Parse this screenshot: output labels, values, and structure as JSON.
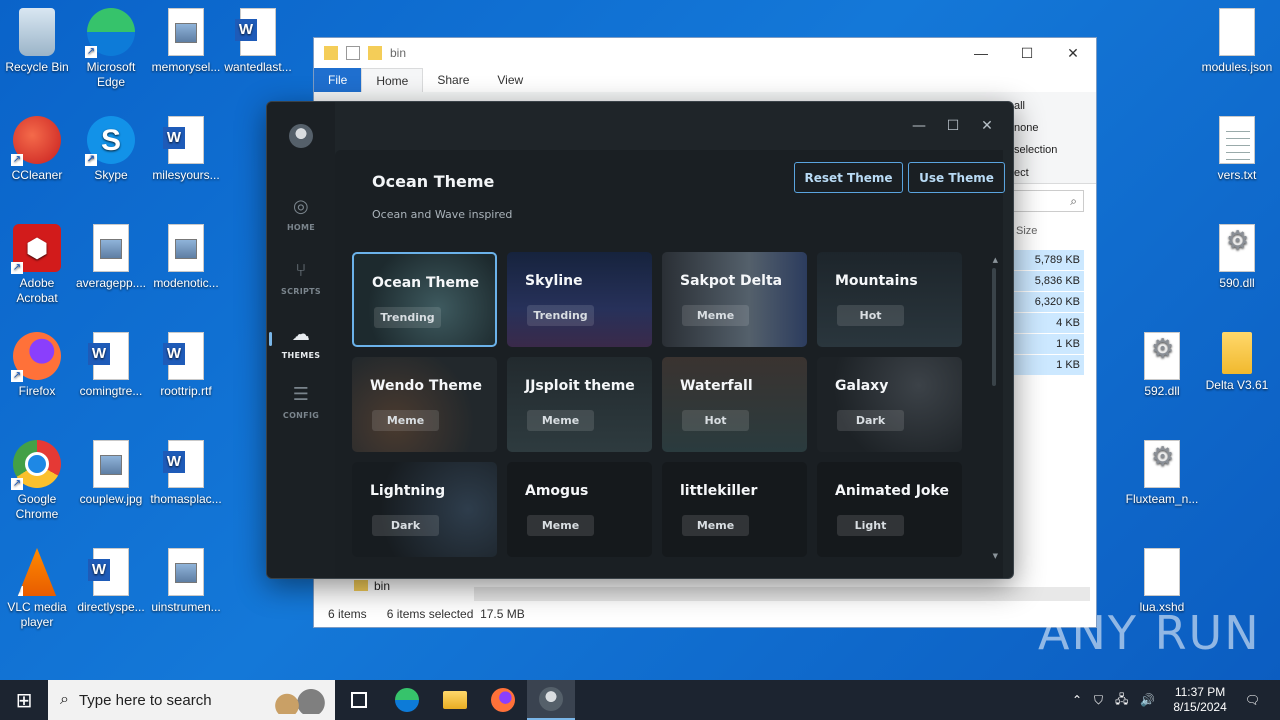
{
  "desktop": {
    "icons": [
      {
        "label": "Recycle Bin"
      },
      {
        "label": "Microsoft Edge"
      },
      {
        "label": "memorysel..."
      },
      {
        "label": "wantedlast..."
      },
      {
        "label": "CCleaner"
      },
      {
        "label": "Skype"
      },
      {
        "label": "milesyours..."
      },
      {
        "label": "Adobe Acrobat"
      },
      {
        "label": "averagepp...."
      },
      {
        "label": "modenotic..."
      },
      {
        "label": "Firefox"
      },
      {
        "label": "comingtre..."
      },
      {
        "label": "roottrip.rtf"
      },
      {
        "label": "Google Chrome"
      },
      {
        "label": "couplew.jpg"
      },
      {
        "label": "thomasplac..."
      },
      {
        "label": "VLC media player"
      },
      {
        "label": "directlyspe..."
      },
      {
        "label": "uinstrumen..."
      },
      {
        "label": "modules.json"
      },
      {
        "label": "vers.txt"
      },
      {
        "label": "590.dll"
      },
      {
        "label": "592.dll"
      },
      {
        "label": "Delta V3.61"
      },
      {
        "label": "Fluxteam_n..."
      },
      {
        "label": "lua.xshd"
      }
    ]
  },
  "explorer": {
    "title": "bin",
    "tabs": [
      "File",
      "Home",
      "Share",
      "View"
    ],
    "ribbon_select": [
      "all",
      "none",
      "selection",
      "ect"
    ],
    "size_header": "Size",
    "sizes": [
      "5,789 KB",
      "5,836 KB",
      "6,320 KB",
      "4 KB",
      "1 KB",
      "1 KB"
    ],
    "nav_folder": "bin",
    "status": {
      "items": "6 items",
      "selected": "6 items selected",
      "size": "17.5 MB"
    }
  },
  "app": {
    "nav": [
      {
        "label": "HOME",
        "icon": "compass-icon"
      },
      {
        "label": "SCRIPTS",
        "icon": "branch-icon"
      },
      {
        "label": "THEMES",
        "icon": "cloud-icon"
      },
      {
        "label": "CONFIG",
        "icon": "sliders-icon"
      }
    ],
    "header": {
      "title": "Ocean Theme",
      "description": "Ocean and Wave inspired",
      "reset_label": "Reset Theme",
      "use_label": "Use Theme"
    },
    "themes": [
      {
        "name": "Ocean Theme",
        "tag": "Trending"
      },
      {
        "name": "Skyline",
        "tag": "Trending"
      },
      {
        "name": "Sakpot Delta",
        "tag": "Meme"
      },
      {
        "name": "Mountains",
        "tag": "Hot"
      },
      {
        "name": "Wendo Theme",
        "tag": "Meme"
      },
      {
        "name": "JJsploit theme",
        "tag": "Meme"
      },
      {
        "name": "Waterfall",
        "tag": "Hot"
      },
      {
        "name": "Galaxy",
        "tag": "Dark"
      },
      {
        "name": "Lightning",
        "tag": "Dark"
      },
      {
        "name": "Amogus",
        "tag": "Meme"
      },
      {
        "name": "littlekiller",
        "tag": "Meme"
      },
      {
        "name": "Animated Joke",
        "tag": "Light"
      }
    ]
  },
  "taskbar": {
    "search_placeholder": "Type here to search",
    "time": "11:37 PM",
    "date": "8/15/2024"
  },
  "watermark": "ANY RUN"
}
